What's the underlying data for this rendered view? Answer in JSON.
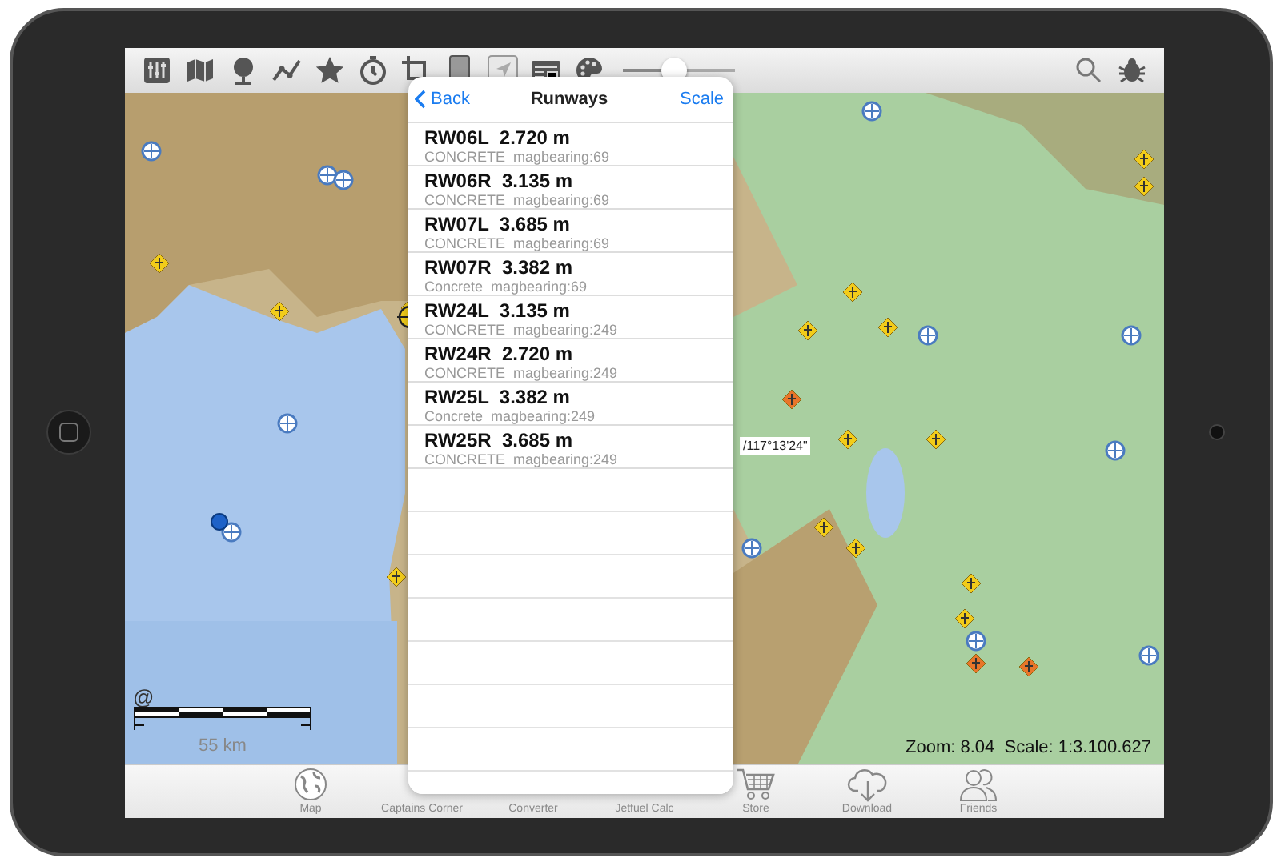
{
  "toolbar": {
    "tools": [
      {
        "kind": "sliders"
      },
      {
        "kind": "map"
      },
      {
        "kind": "globe"
      },
      {
        "kind": "route"
      },
      {
        "kind": "star"
      },
      {
        "kind": "timer"
      },
      {
        "kind": "crop"
      },
      {
        "kind": "tablet"
      },
      {
        "kind": "cursor"
      },
      {
        "kind": "card"
      },
      {
        "kind": "palette"
      }
    ],
    "slider": {
      "level": 0.45
    },
    "right_tools": [
      {
        "kind": "search"
      },
      {
        "kind": "bug"
      }
    ]
  },
  "map": {
    "copyright": "@",
    "scale_label": "55 km",
    "coordinate": "/117°13'24\"",
    "status": "Zoom: 8.04  Scale: 1:3.100.627"
  },
  "popover": {
    "back": "Back",
    "title": "Runways",
    "action": "Scale",
    "runways": [
      {
        "title": "RW06L  2.720 m",
        "detail": "CONCRETE  magbearing:69"
      },
      {
        "title": "RW06R  3.135 m",
        "detail": "CONCRETE  magbearing:69"
      },
      {
        "title": "RW07L  3.685 m",
        "detail": "CONCRETE  magbearing:69"
      },
      {
        "title": "RW07R  3.382 m",
        "detail": "Concrete  magbearing:69"
      },
      {
        "title": "RW24L  3.135 m",
        "detail": "CONCRETE  magbearing:249"
      },
      {
        "title": "RW24R  2.720 m",
        "detail": "CONCRETE  magbearing:249"
      },
      {
        "title": "RW25L  3.382 m",
        "detail": "Concrete  magbearing:249"
      },
      {
        "title": "RW25R  3.685 m",
        "detail": "CONCRETE  magbearing:249"
      }
    ]
  },
  "tab_bar": [
    {
      "label": "Map",
      "kind": "globe"
    },
    {
      "label": "Captains Corner",
      "kind": "hidden"
    },
    {
      "label": "Converter",
      "kind": "hidden"
    },
    {
      "label": "Jetfuel Calc",
      "kind": "hidden"
    },
    {
      "label": "Store",
      "kind": "cart"
    },
    {
      "label": "Download",
      "kind": "cloud"
    },
    {
      "label": "Friends",
      "kind": "people"
    }
  ]
}
